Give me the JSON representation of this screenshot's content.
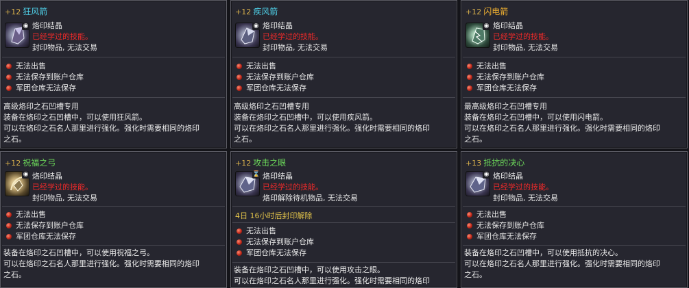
{
  "cards": [
    {
      "level": "+12",
      "name": "狂风箭",
      "name_color": "#4fd0e8",
      "type": "烙印结晶",
      "learned": "已经学过的技能。",
      "seal": "封印物品, 无法交易",
      "restrictions": [
        "无法出售",
        "无法保存到账户仓库",
        "军团仓库无法保存"
      ],
      "desc": [
        "高级烙印之石凹槽专用",
        "装备在烙印之石凹槽中，可以使用狂风箭。",
        "可以在烙印之石名人那里进行强化。强化时需要相同的烙印",
        "之石。"
      ]
    },
    {
      "level": "+12",
      "name": "疾风箭",
      "name_color": "#4fd0e8",
      "type": "烙印结晶",
      "learned": "已经学过的技能。",
      "seal": "封印物品, 无法交易",
      "restrictions": [
        "无法出售",
        "无法保存到账户仓库",
        "军团仓库无法保存"
      ],
      "desc": [
        "高级烙印之石凹槽专用",
        "装备在烙印之石凹槽中，可以使用疾风箭。",
        "可以在烙印之石名人那里进行强化。强化时需要相同的烙印",
        "之石。"
      ]
    },
    {
      "level": "+12",
      "name": "闪电箭",
      "name_color": "#f0b030",
      "type": "烙印结晶",
      "learned": "已经学过的技能。",
      "seal": "封印物品, 无法交易",
      "restrictions": [
        "无法出售",
        "无法保存到账户仓库",
        "军团仓库无法保存"
      ],
      "desc": [
        "最高级烙印之石凹槽专用",
        "装备在烙印之石凹槽中，可以使用闪电箭。",
        "可以在烙印之石名人那里进行强化。强化时需要相同的烙印",
        "之石。"
      ]
    },
    {
      "level": "+12",
      "name": "祝福之弓",
      "name_color": "#6cd85a",
      "type": "烙印结晶",
      "learned": "已经学过的技能。",
      "seal": "封印物品, 无法交易",
      "restrictions": [
        "无法出售",
        "无法保存到账户仓库",
        "军团仓库无法保存"
      ],
      "desc": [
        "装备在烙印之石凹槽中，可以使用祝福之弓。",
        "可以在烙印之石名人那里进行强化。强化时需要相同的烙印",
        "之石。"
      ]
    },
    {
      "level": "+12",
      "name": "攻击之眼",
      "name_color": "#6cd85a",
      "type": "烙印结晶",
      "learned": "已经学过的技能。",
      "seal": "烙印解除待机物品, 无法交易",
      "time": "4日 16小时后封印解除",
      "restrictions": [
        "无法出售",
        "无法保存到账户仓库",
        "军团仓库无法保存"
      ],
      "desc": [
        "装备在烙印之石凹槽中，可以使用攻击之眼。",
        "可以在烙印之石名人那里进行强化。强化时需要相同的烙印"
      ]
    },
    {
      "level": "+13",
      "name": "抵抗的决心",
      "name_color": "#6cd85a",
      "type": "烙印结晶",
      "learned": "已经学过的技能。",
      "seal": "封印物品, 无法交易",
      "restrictions": [
        "无法出售",
        "无法保存到账户仓库",
        "军团仓库无法保存"
      ],
      "desc": [
        "装备在烙印之石凹槽中，可以使用抵抗的决心。",
        "可以在烙印之石名人那里进行强化。强化时需要相同的烙印",
        "之石。"
      ]
    }
  ]
}
